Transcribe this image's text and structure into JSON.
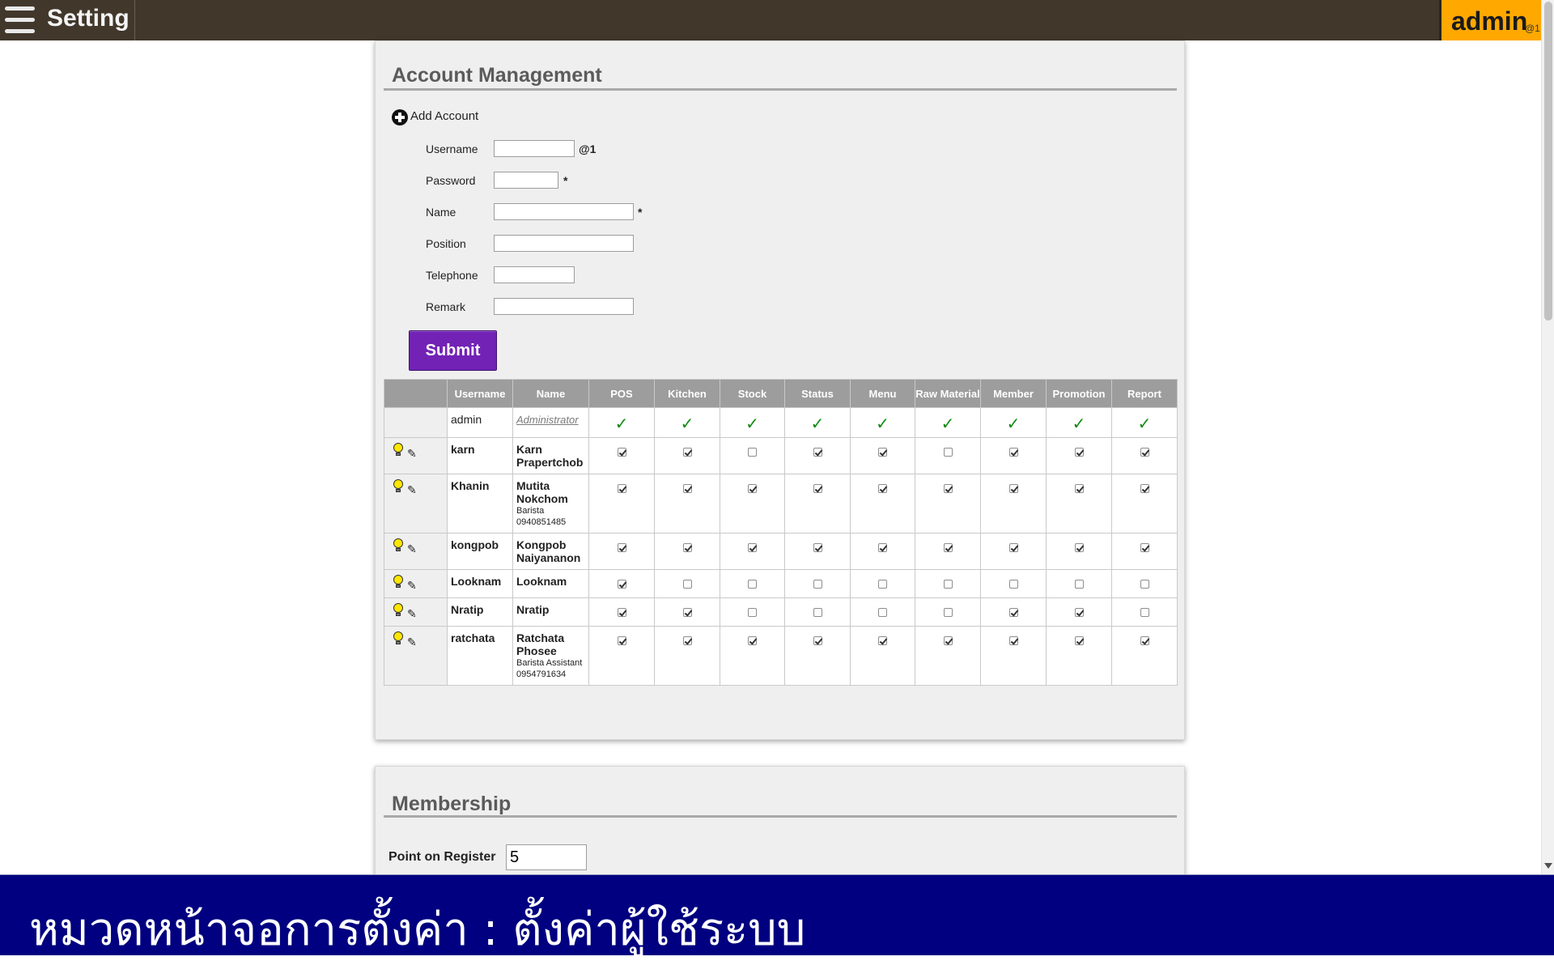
{
  "app": {
    "title": "Setting",
    "user": "admin",
    "shop": "@1"
  },
  "account": {
    "heading": "Account Management",
    "add_label": "Add Account",
    "form": {
      "username_label": "Username",
      "username_suffix": "@1",
      "password_label": "Password",
      "password_suffix": "*",
      "name_label": "Name",
      "name_suffix": "*",
      "position_label": "Position",
      "telephone_label": "Telephone",
      "remark_label": "Remark",
      "submit_label": "Submit"
    },
    "columns": [
      "",
      "Username",
      "Name",
      "POS",
      "Kitchen",
      "Stock",
      "Status",
      "Menu",
      "Raw Material",
      "Member",
      "Promotion",
      "Report"
    ],
    "admin_row": {
      "username": "admin",
      "name": "Administrator",
      "tick": "✓"
    },
    "users": [
      {
        "username": "karn",
        "name": "Karn Prapertchob",
        "position": "",
        "telephone": "",
        "perms": [
          true,
          true,
          false,
          true,
          true,
          false,
          true,
          true,
          true
        ]
      },
      {
        "username": "Khanin",
        "name": "Mutita Nokchom",
        "position": "Barista",
        "telephone": "0940851485",
        "perms": [
          true,
          true,
          true,
          true,
          true,
          true,
          true,
          true,
          true
        ]
      },
      {
        "username": "kongpob",
        "name": "Kongpob Naiyananon",
        "position": "",
        "telephone": "",
        "perms": [
          true,
          true,
          true,
          true,
          true,
          true,
          true,
          true,
          true
        ]
      },
      {
        "username": "Looknam",
        "name": "Looknam",
        "position": "",
        "telephone": "",
        "perms": [
          true,
          false,
          false,
          false,
          false,
          false,
          false,
          false,
          false
        ]
      },
      {
        "username": "Nratip",
        "name": "Nratip",
        "position": "",
        "telephone": "",
        "perms": [
          true,
          true,
          false,
          false,
          false,
          false,
          true,
          true,
          false
        ]
      },
      {
        "username": "ratchata",
        "name": "Ratchata Phosee",
        "position": "Barista Assistant",
        "telephone": "0954791634",
        "perms": [
          true,
          true,
          true,
          true,
          true,
          true,
          true,
          true,
          true
        ]
      }
    ]
  },
  "membership": {
    "heading": "Membership",
    "point_label": "Point on Register",
    "point_value": "5"
  },
  "caption": "หมวดหน้าจอการตั้งค่า : ตั้งค่าผู้ใช้ระบบ"
}
